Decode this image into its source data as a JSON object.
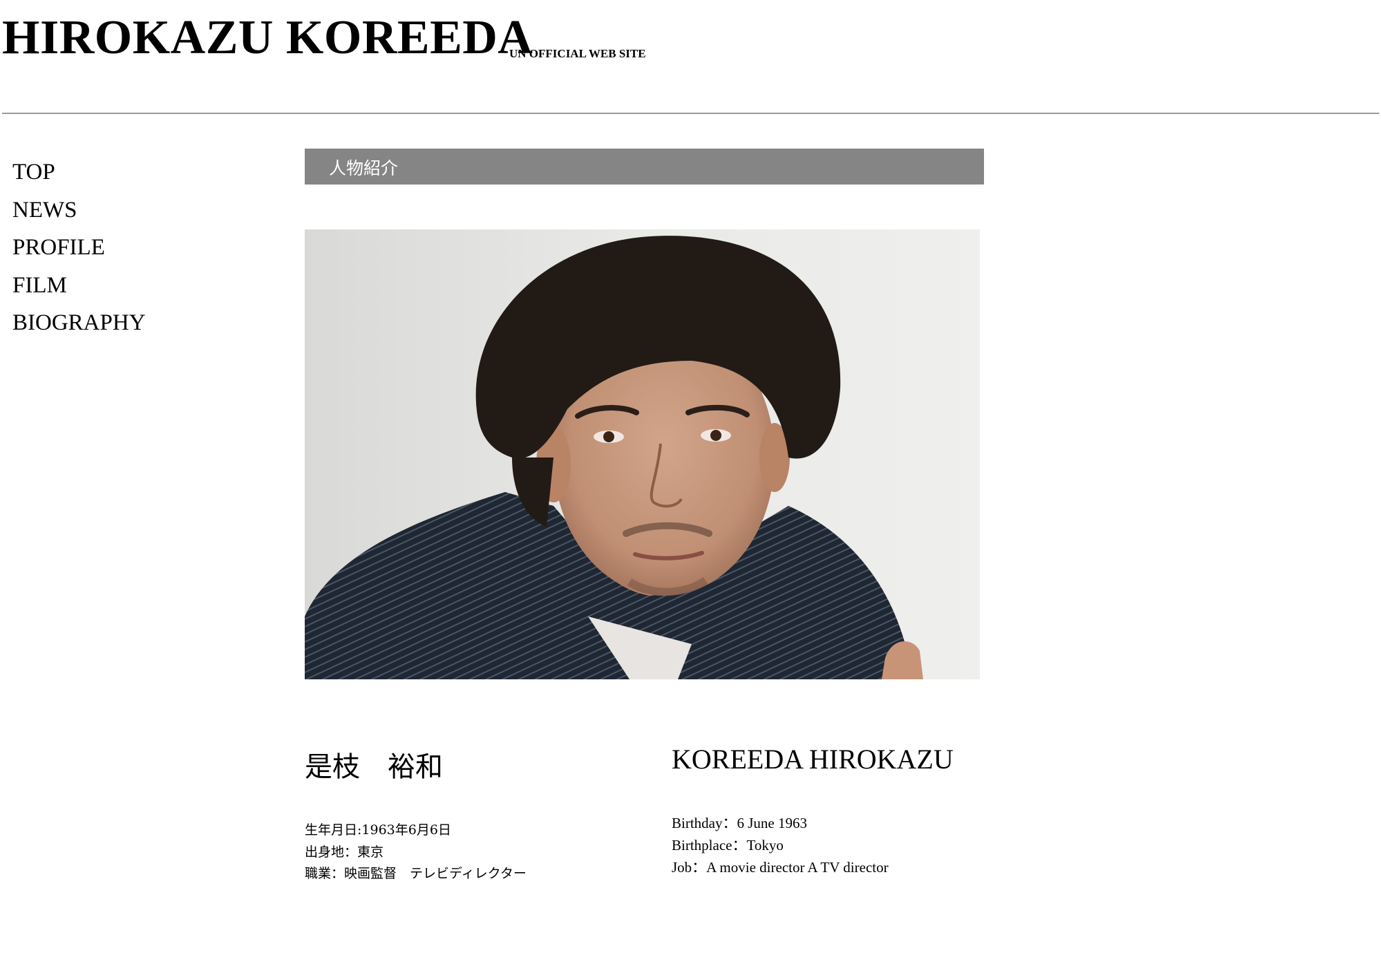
{
  "header": {
    "site_title": "HIROKAZU KOREEDA",
    "site_subtitle": "UN OFFICIAL WEB SITE"
  },
  "nav": {
    "items": [
      {
        "label": "TOP"
      },
      {
        "label": "NEWS"
      },
      {
        "label": "PROFILE"
      },
      {
        "label": "FILM"
      },
      {
        "label": "BIOGRAPHY"
      }
    ]
  },
  "main": {
    "section_title": "人物紹介",
    "photo_icon": "portrait-photo",
    "profile_jp": {
      "name": "是枝　裕和",
      "details": [
        "生年月日:1963年6月6日",
        "出身地：東京",
        "職業：映画監督　テレビディレクター"
      ]
    },
    "profile_en": {
      "name": "KOREEDA HIROKAZU",
      "details": [
        "Birthday：6 June 1963",
        "Birthplace：Tokyo",
        "Job：A movie director A TV director"
      ]
    }
  },
  "colors": {
    "section_bar": "#858585",
    "header_rule": "#9a9a9a",
    "photo_background": "#e6e6e4"
  }
}
